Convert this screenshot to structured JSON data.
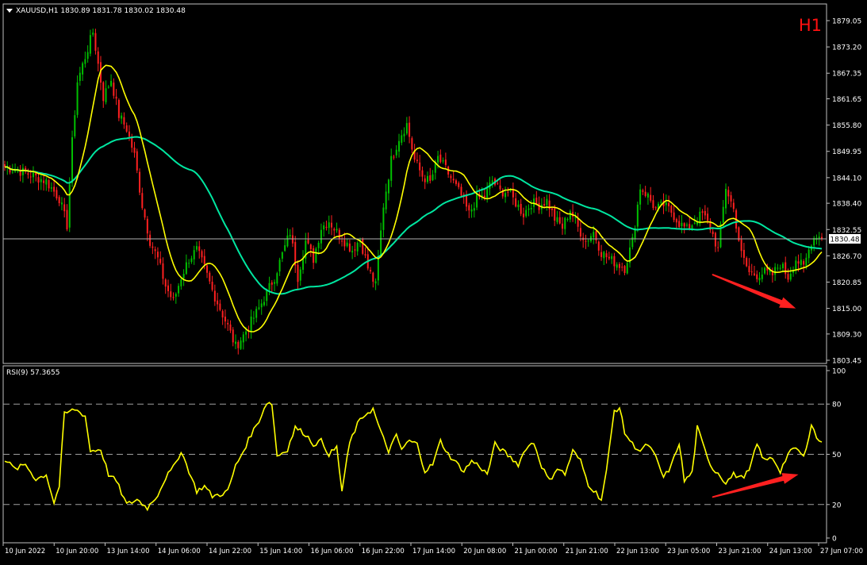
{
  "header": {
    "symbol_line": "XAUUSD,H1  1830.89 1831.78 1830.02 1830.48",
    "timeframe_badge": "H1"
  },
  "colors": {
    "background": "#000000",
    "frame": "#c0c0c0",
    "bull_candle": "#00c000",
    "bear_candle": "#ff2020",
    "ma_fast": "#ffff00",
    "ma_slow": "#00e6a0",
    "rsi_line": "#ffff00",
    "arrow": "#ff2020",
    "badge": "#ff1010",
    "price_line": "#b0b0b0",
    "price_tag_bg": "#ffffff"
  },
  "chart_data": [
    {
      "type": "candlestick",
      "title": "XAUUSD,H1",
      "ohlc_last": {
        "open": 1830.89,
        "high": 1831.78,
        "low": 1830.02,
        "close": 1830.48
      },
      "current_price_label": "1830.48",
      "current_price": 1830.48,
      "ylim": [
        1803.45,
        1879.05
      ],
      "y_ticks": [
        "1879.05",
        "1873.20",
        "1867.35",
        "1861.65",
        "1855.80",
        "1849.95",
        "1844.10",
        "1838.40",
        "1832.55",
        "1826.70",
        "1820.85",
        "1815.00",
        "1809.30",
        "1803.45"
      ],
      "x_ticks": [
        "10 Jun 2022",
        "10 Jun 20:00",
        "13 Jun 14:00",
        "14 Jun 06:00",
        "14 Jun 22:00",
        "15 Jun 14:00",
        "16 Jun 06:00",
        "16 Jun 22:00",
        "17 Jun 14:00",
        "20 Jun 08:00",
        "21 Jun 00:00",
        "21 Jun 21:00",
        "22 Jun 13:00",
        "23 Jun 05:00",
        "23 Jun 21:00",
        "24 Jun 13:00",
        "27 Jun 07:00"
      ],
      "close_path_anchors": [
        [
          0,
          1846.5
        ],
        [
          8,
          1845.2
        ],
        [
          16,
          1843.3
        ],
        [
          21,
          1839.5
        ],
        [
          24,
          1833.5
        ],
        [
          26,
          1852.0
        ],
        [
          28,
          1865.5
        ],
        [
          31,
          1871.0
        ],
        [
          34,
          1876.5
        ],
        [
          35,
          1873.0
        ],
        [
          38,
          1862.0
        ],
        [
          41,
          1866.0
        ],
        [
          44,
          1858.0
        ],
        [
          47,
          1855.0
        ],
        [
          50,
          1849.0
        ],
        [
          53,
          1838.0
        ],
        [
          56,
          1830.0
        ],
        [
          59,
          1826.0
        ],
        [
          62,
          1820.0
        ],
        [
          65,
          1816.5
        ],
        [
          68,
          1822.0
        ],
        [
          71,
          1826.0
        ],
        [
          74,
          1828.0
        ],
        [
          77,
          1824.0
        ],
        [
          80,
          1819.0
        ],
        [
          83,
          1815.0
        ],
        [
          86,
          1811.0
        ],
        [
          89,
          1806.5
        ],
        [
          92,
          1809.0
        ],
        [
          95,
          1812.0
        ],
        [
          98,
          1815.0
        ],
        [
          101,
          1818.5
        ],
        [
          104,
          1822.0
        ],
        [
          107,
          1827.0
        ],
        [
          110,
          1832.0
        ],
        [
          113,
          1822.0
        ],
        [
          116,
          1830.0
        ],
        [
          119,
          1826.0
        ],
        [
          122,
          1833.0
        ],
        [
          125,
          1834.5
        ],
        [
          128,
          1832.0
        ],
        [
          131,
          1830.0
        ],
        [
          134,
          1828.0
        ],
        [
          137,
          1830.5
        ],
        [
          140,
          1824.0
        ],
        [
          143,
          1820.0
        ],
        [
          146,
          1838.0
        ],
        [
          149,
          1848.0
        ],
        [
          152,
          1853.0
        ],
        [
          155,
          1856.0
        ],
        [
          158,
          1848.0
        ],
        [
          161,
          1844.5
        ],
        [
          164,
          1843.0
        ],
        [
          167,
          1848.5
        ],
        [
          170,
          1846.0
        ],
        [
          173,
          1843.0
        ],
        [
          176,
          1840.0
        ],
        [
          179,
          1836.0
        ],
        [
          182,
          1839.5
        ],
        [
          185,
          1840.0
        ],
        [
          188,
          1843.5
        ],
        [
          191,
          1841.0
        ],
        [
          194,
          1841.0
        ],
        [
          197,
          1838.5
        ],
        [
          200,
          1836.0
        ],
        [
          203,
          1838.5
        ],
        [
          206,
          1838.0
        ],
        [
          209,
          1839.0
        ],
        [
          212,
          1835.0
        ],
        [
          215,
          1833.0
        ],
        [
          218,
          1837.0
        ],
        [
          221,
          1833.0
        ],
        [
          224,
          1830.0
        ],
        [
          227,
          1832.0
        ],
        [
          230,
          1827.5
        ],
        [
          233,
          1826.0
        ],
        [
          236,
          1825.0
        ],
        [
          239,
          1824.0
        ],
        [
          242,
          1830.0
        ],
        [
          245,
          1842.0
        ],
        [
          248,
          1840.0
        ],
        [
          251,
          1837.0
        ],
        [
          254,
          1838.0
        ],
        [
          257,
          1836.5
        ],
        [
          260,
          1834.0
        ],
        [
          263,
          1832.5
        ],
        [
          266,
          1834.5
        ],
        [
          269,
          1836.0
        ],
        [
          272,
          1833.0
        ],
        [
          275,
          1828.0
        ],
        [
          278,
          1842.0
        ],
        [
          281,
          1837.0
        ],
        [
          284,
          1827.0
        ],
        [
          287,
          1823.0
        ],
        [
          290,
          1822.5
        ],
        [
          293,
          1823.0
        ],
        [
          296,
          1822.5
        ],
        [
          299,
          1825.0
        ],
        [
          302,
          1822.0
        ],
        [
          305,
          1826.0
        ],
        [
          308,
          1824.0
        ],
        [
          311,
          1830.0
        ],
        [
          313,
          1831.5
        ],
        [
          315,
          1830.48
        ]
      ],
      "series": [
        {
          "name": "fast moving average",
          "period": 12
        },
        {
          "name": "slow moving average",
          "period": 48
        }
      ],
      "annotations": [
        {
          "type": "arrow",
          "panel": "price",
          "direction": "down",
          "from": [
            273,
            1822.5
          ],
          "to": [
            305,
            1815.0
          ]
        }
      ],
      "grid": false
    },
    {
      "type": "line",
      "title": "RSI(9) 57.3655",
      "indicator": "RSI",
      "period": 9,
      "current_value": 57.3655,
      "ylim": [
        0,
        100
      ],
      "y_ticks": [
        "100",
        "80",
        "50",
        "20",
        "0"
      ],
      "levels": [
        80,
        50,
        20
      ],
      "points": [
        [
          0,
          47
        ],
        [
          4,
          41
        ],
        [
          8,
          44
        ],
        [
          12,
          35
        ],
        [
          16,
          38
        ],
        [
          19,
          21
        ],
        [
          21,
          31
        ],
        [
          23,
          74
        ],
        [
          27,
          77
        ],
        [
          31,
          73
        ],
        [
          33,
          52
        ],
        [
          37,
          53
        ],
        [
          40,
          38
        ],
        [
          43,
          34
        ],
        [
          47,
          20
        ],
        [
          51,
          23
        ],
        [
          55,
          18
        ],
        [
          59,
          26
        ],
        [
          62,
          36
        ],
        [
          65,
          42
        ],
        [
          68,
          52
        ],
        [
          71,
          40
        ],
        [
          74,
          28
        ],
        [
          77,
          31
        ],
        [
          80,
          25
        ],
        [
          83,
          26
        ],
        [
          86,
          28
        ],
        [
          89,
          43
        ],
        [
          92,
          52
        ],
        [
          95,
          62
        ],
        [
          98,
          70
        ],
        [
          101,
          81
        ],
        [
          103,
          80
        ],
        [
          105,
          49
        ],
        [
          109,
          53
        ],
        [
          112,
          66
        ],
        [
          116,
          62
        ],
        [
          119,
          56
        ],
        [
          122,
          58
        ],
        [
          125,
          50
        ],
        [
          128,
          54
        ],
        [
          130,
          28
        ],
        [
          133,
          57
        ],
        [
          136,
          68
        ],
        [
          139,
          74
        ],
        [
          142,
          77
        ],
        [
          145,
          63
        ],
        [
          148,
          52
        ],
        [
          151,
          61
        ],
        [
          153,
          53
        ],
        [
          156,
          58
        ],
        [
          159,
          56
        ],
        [
          162,
          40
        ],
        [
          165,
          44
        ],
        [
          168,
          58
        ],
        [
          171,
          50
        ],
        [
          174,
          45
        ],
        [
          177,
          40
        ],
        [
          180,
          46
        ],
        [
          183,
          43
        ],
        [
          186,
          38
        ],
        [
          189,
          56
        ],
        [
          192,
          52
        ],
        [
          195,
          48
        ],
        [
          198,
          44
        ],
        [
          201,
          54
        ],
        [
          204,
          57
        ],
        [
          207,
          43
        ],
        [
          210,
          34
        ],
        [
          213,
          42
        ],
        [
          216,
          38
        ],
        [
          219,
          52
        ],
        [
          222,
          46
        ],
        [
          225,
          32
        ],
        [
          228,
          27
        ],
        [
          230,
          23
        ],
        [
          232,
          40
        ],
        [
          235,
          76
        ],
        [
          237,
          78
        ],
        [
          239,
          63
        ],
        [
          242,
          56
        ],
        [
          245,
          52
        ],
        [
          248,
          56
        ],
        [
          251,
          48
        ],
        [
          254,
          36
        ],
        [
          257,
          43
        ],
        [
          260,
          57
        ],
        [
          262,
          34
        ],
        [
          265,
          39
        ],
        [
          267,
          66
        ],
        [
          270,
          52
        ],
        [
          273,
          41
        ],
        [
          275,
          39
        ],
        [
          278,
          33
        ],
        [
          281,
          38
        ],
        [
          284,
          36
        ],
        [
          287,
          40
        ],
        [
          290,
          56
        ],
        [
          293,
          46
        ],
        [
          296,
          48
        ],
        [
          299,
          40
        ],
        [
          302,
          50
        ],
        [
          305,
          54
        ],
        [
          308,
          48
        ],
        [
          311,
          68
        ],
        [
          313,
          60
        ],
        [
          315,
          57.3655
        ]
      ],
      "annotations": [
        {
          "type": "arrow",
          "panel": "rsi",
          "direction": "up",
          "from": [
            273,
            24.5
          ],
          "to": [
            306,
            38.0
          ]
        }
      ]
    }
  ]
}
